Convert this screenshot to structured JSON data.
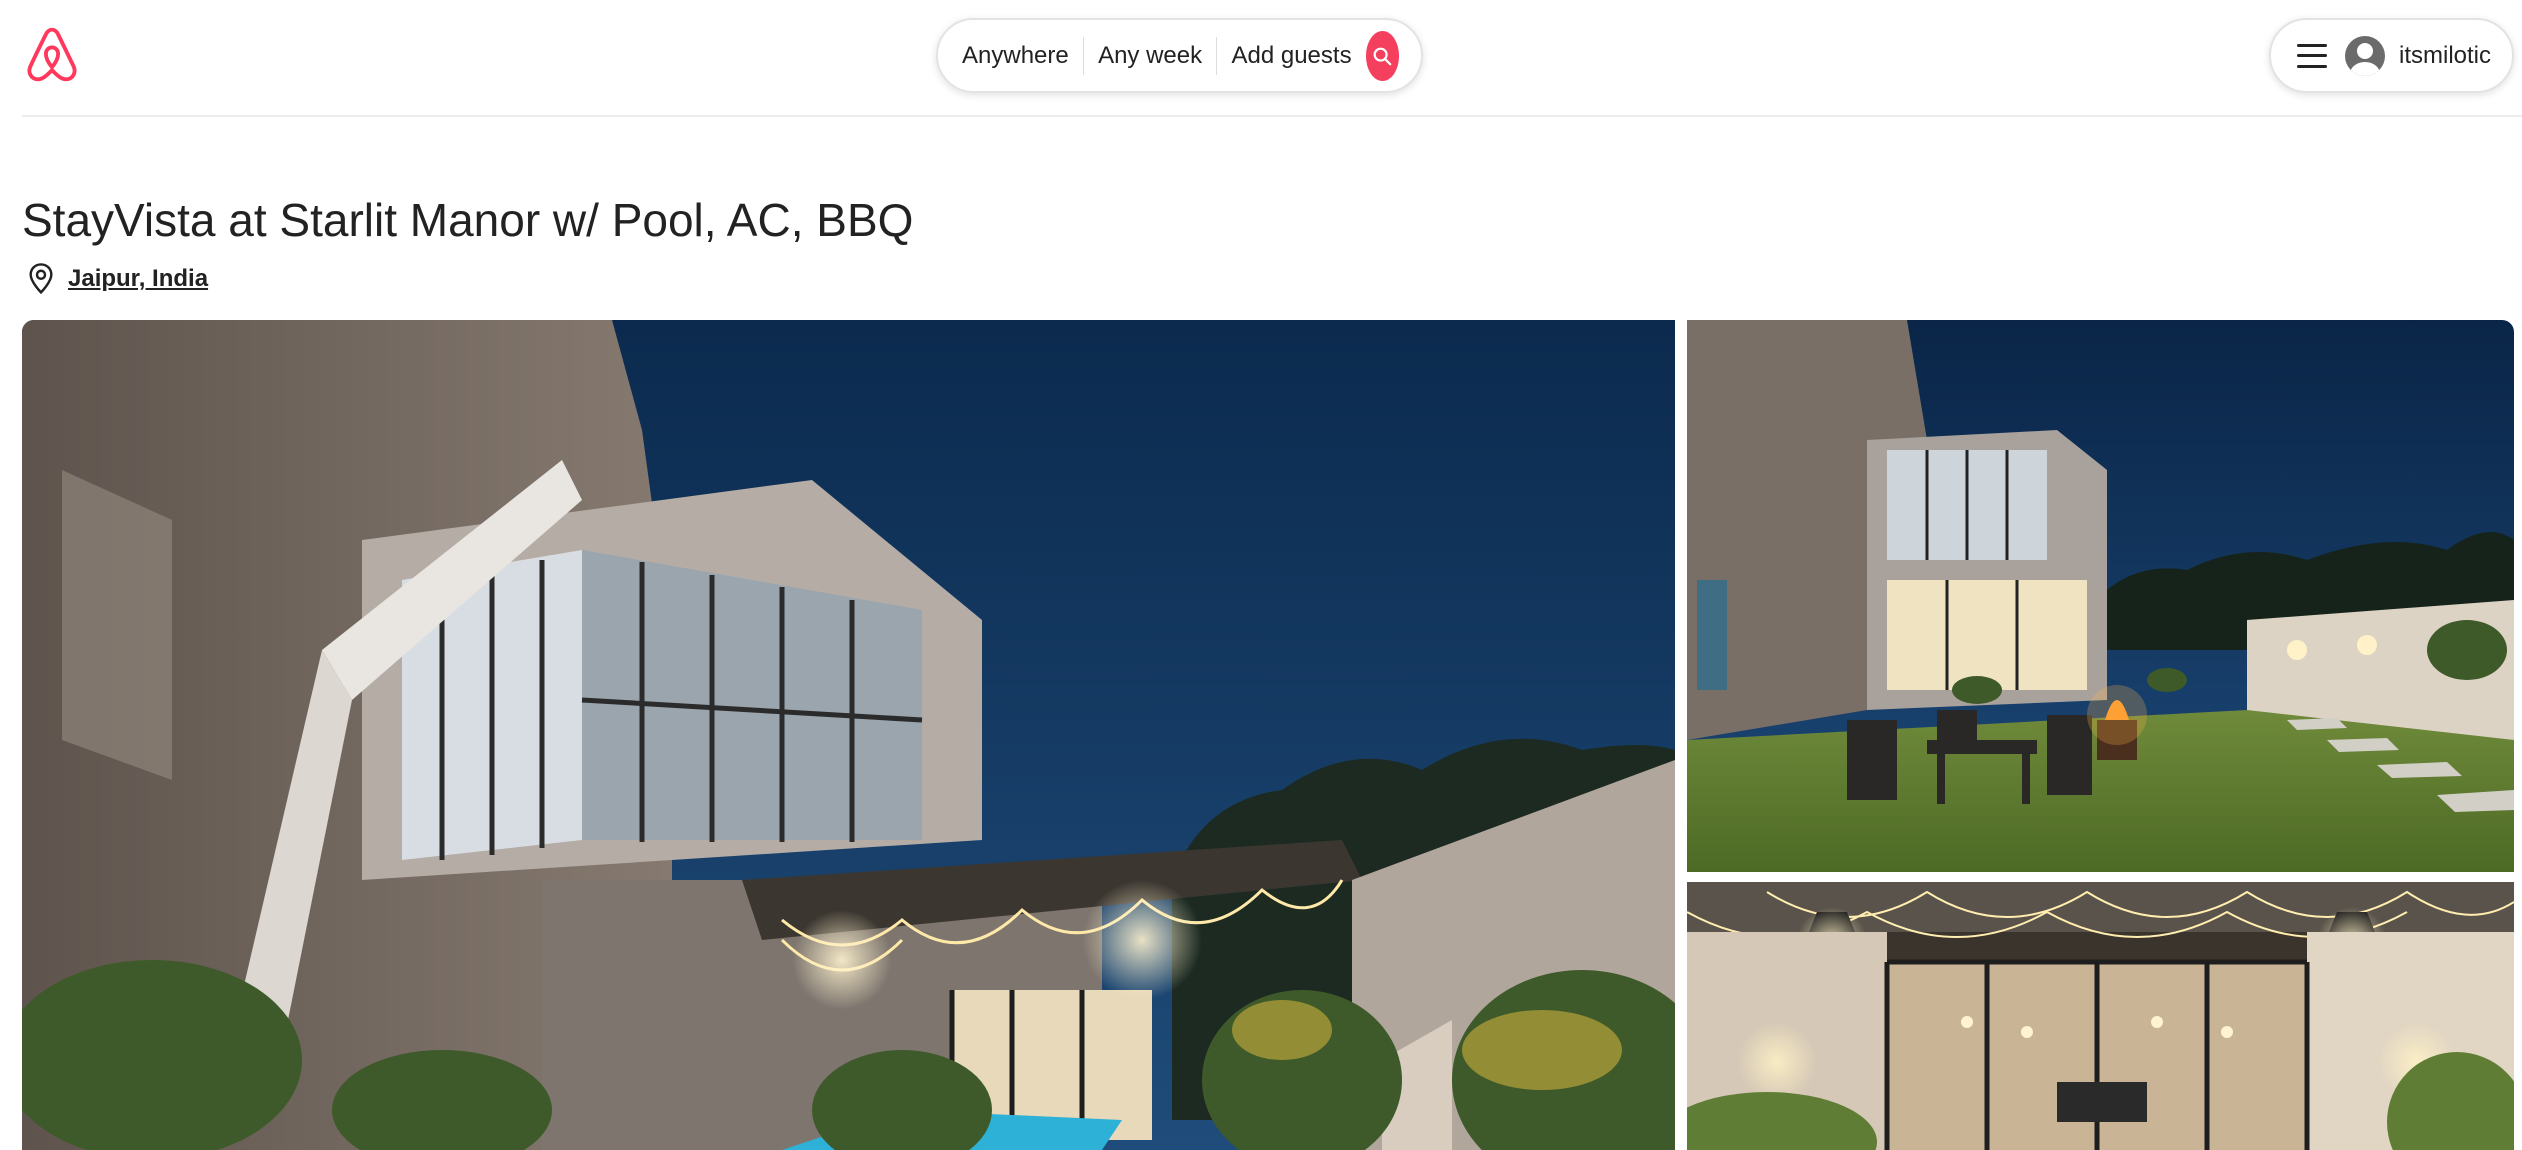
{
  "header": {
    "logo_icon": "airbnb-logo-icon",
    "search": {
      "location": "Anywhere",
      "dates": "Any week",
      "guests": "Add guests",
      "button_icon": "search-icon"
    },
    "user_menu": {
      "menu_icon": "hamburger-menu-icon",
      "avatar_icon": "user-avatar-icon",
      "username": "itsmilotic"
    }
  },
  "listing": {
    "title": "StayVista at Starlit Manor w/ Pool, AC, BBQ",
    "location_icon": "map-pin-icon",
    "location": "Jaipur, India"
  },
  "gallery": {
    "photos": [
      "villa-exterior-night-photo",
      "villa-garden-firepit-photo",
      "patio-string-lights-photo"
    ]
  },
  "colors": {
    "brand": "#ff385c",
    "search_button": "#f43f5e",
    "text": "#222222"
  }
}
